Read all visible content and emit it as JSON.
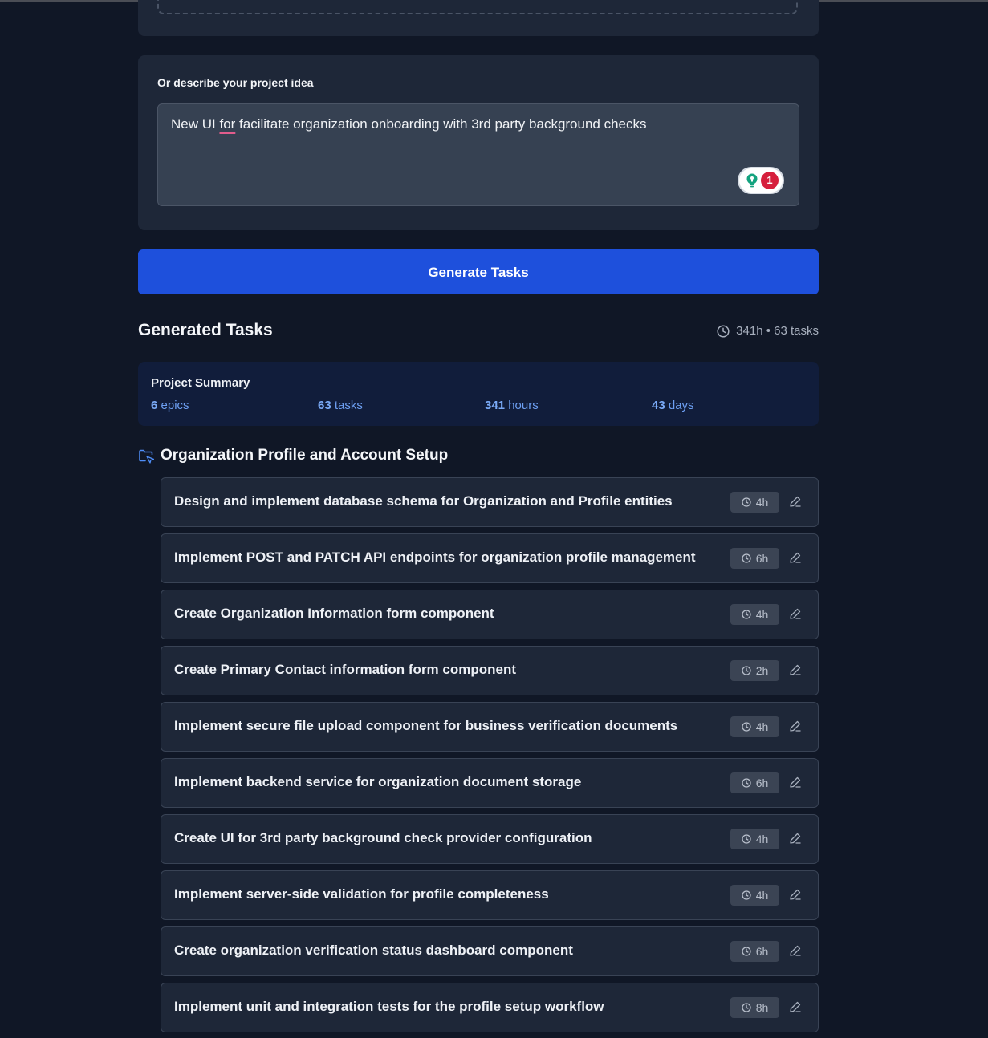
{
  "idea": {
    "label": "Or describe your project idea",
    "text_before": "New UI ",
    "flagged_word": "for",
    "text_after": " facilitate organization onboarding with 3rd party background checks",
    "grammar_issue_count": "1"
  },
  "generate_button": {
    "label": "Generate Tasks"
  },
  "generated": {
    "title": "Generated Tasks",
    "totals": "341h • 63 tasks"
  },
  "summary": {
    "title": "Project Summary",
    "stats": [
      {
        "value": "6",
        "unit": "epics"
      },
      {
        "value": "63",
        "unit": "tasks"
      },
      {
        "value": "341",
        "unit": "hours"
      },
      {
        "value": "43",
        "unit": "days"
      }
    ]
  },
  "epic": {
    "title": "Organization Profile and Account Setup",
    "tasks": [
      {
        "title": "Design and implement database schema for Organization and Profile entities",
        "hours": "4h"
      },
      {
        "title": "Implement POST and PATCH API endpoints for organization profile management",
        "hours": "6h"
      },
      {
        "title": "Create Organization Information form component",
        "hours": "4h"
      },
      {
        "title": "Create Primary Contact information form component",
        "hours": "2h"
      },
      {
        "title": "Implement secure file upload component for business verification documents",
        "hours": "4h"
      },
      {
        "title": "Implement backend service for organization document storage",
        "hours": "6h"
      },
      {
        "title": "Create UI for 3rd party background check provider configuration",
        "hours": "4h"
      },
      {
        "title": "Implement server-side validation for profile completeness",
        "hours": "4h"
      },
      {
        "title": "Create organization verification status dashboard component",
        "hours": "6h"
      },
      {
        "title": "Implement unit and integration tests for the profile setup workflow",
        "hours": "8h"
      }
    ]
  },
  "colors": {
    "background": "#101726",
    "card": "#1e2738",
    "primary_button": "#1e50dc",
    "summary_card": "#111d3b",
    "summary_stat": "#6d9ff2",
    "folder_icon": "#4f8ef7"
  }
}
